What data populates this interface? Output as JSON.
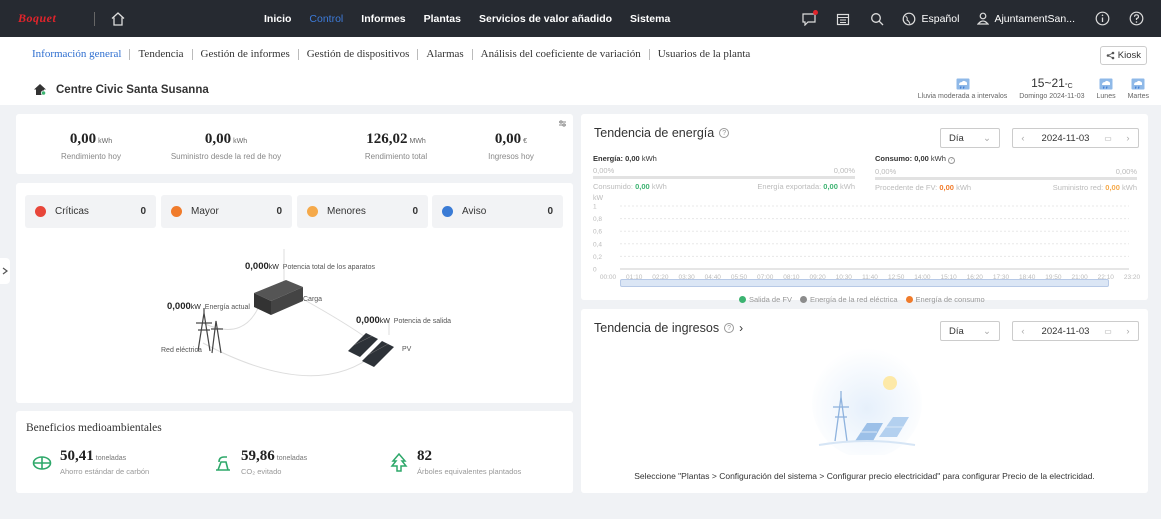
{
  "topbar": {
    "logo": "Boquet",
    "nav": [
      "Inicio",
      "Control",
      "Informes",
      "Plantas",
      "Servicios de valor añadido",
      "Sistema"
    ],
    "active_nav": "Control",
    "language": "Español",
    "user": "AjuntamentSan..."
  },
  "subnav": {
    "items": [
      "Información general",
      "Tendencia",
      "Gestión de informes",
      "Gestión de dispositivos",
      "Alarmas",
      "Análisis del coeficiente de variación",
      "Usuarios de la planta"
    ],
    "active": "Información general",
    "kiosk": "Kiosk"
  },
  "plant": {
    "name": "Centre Civic Santa Susanna"
  },
  "weather": {
    "today_desc": "Lluvia moderada a intervalos",
    "temp": "15~21",
    "temp_unit": "°C",
    "today_label": "Domingo 2024-11-03",
    "day2": "Lunes",
    "day3": "Martes"
  },
  "kpis": [
    {
      "value": "0,00",
      "unit": "kWh",
      "label": "Rendimiento hoy"
    },
    {
      "value": "0,00",
      "unit": "kWh",
      "label": "Suministro desde la red de hoy"
    },
    {
      "value": "126,02",
      "unit": "MWh",
      "label": "Rendimiento total"
    },
    {
      "value": "0,00",
      "unit": "€",
      "label": "Ingresos hoy"
    }
  ],
  "alarms": [
    {
      "label": "Críticas",
      "count": "0",
      "color": "#e8463a"
    },
    {
      "label": "Mayor",
      "count": "0",
      "color": "#f07b2b"
    },
    {
      "label": "Menores",
      "count": "0",
      "color": "#f5a94a"
    },
    {
      "label": "Aviso",
      "count": "0",
      "color": "#3a7bd5"
    }
  ],
  "flow": {
    "load_power": "0,000",
    "load_power_unit": "kW",
    "load_power_label": "Potencia total de los aparatos",
    "load_label": "Carga",
    "grid_power": "0,000",
    "grid_power_unit": "kW",
    "grid_power_label": "Energía actual",
    "grid_label": "Red eléctrica",
    "pv_power": "0,000",
    "pv_power_unit": "kW",
    "pv_power_label": "Potencia de salida",
    "pv_label": "PV"
  },
  "energy": {
    "title": "Tendencia de energía",
    "period": "Día",
    "date": "2024-11-03",
    "produccion_label": "Energía:",
    "produccion_value": "0,00",
    "produccion_unit": "kWh",
    "consumo_label": "Consumo:",
    "consumo_value": "0,00",
    "consumo_unit": "kWh",
    "pct_left_a": "0,00%",
    "pct_left_b": "0,00%",
    "pct_right_a": "0,00%",
    "pct_right_b": "0,00%",
    "consumido_label": "Consumido:",
    "consumido_value": "0,00",
    "exportada_label": "Energía exportada:",
    "exportada_value": "0,00",
    "fv_label": "Procedente de FV:",
    "fv_value": "0,00",
    "red_label": "Suministro red:",
    "red_value": "0,00",
    "unit": "kWh",
    "legend": [
      "Salida de FV",
      "Energía de la red eléctrica",
      "Energía de consumo"
    ]
  },
  "chart_data": {
    "type": "line",
    "ylabel": "kW",
    "ylim": [
      0,
      1
    ],
    "yticks": [
      "1",
      "0,8",
      "0,6",
      "0,4",
      "0,2",
      "0"
    ],
    "categories": [
      "00:00",
      "01:10",
      "02:20",
      "03:30",
      "04:40",
      "05:50",
      "07:00",
      "08:10",
      "09:20",
      "10:30",
      "11:40",
      "12:50",
      "14:00",
      "15:10",
      "16:20",
      "17:30",
      "18:40",
      "19:50",
      "21:00",
      "22:10",
      "23:20"
    ],
    "series": [
      {
        "name": "Salida de FV",
        "color": "#3cb371",
        "values": []
      },
      {
        "name": "Energía de la red eléctrica",
        "color": "#8c8c8c",
        "values": []
      },
      {
        "name": "Energía de consumo",
        "color": "#f07b2b",
        "values": []
      }
    ]
  },
  "revenue": {
    "title": "Tendencia de ingresos",
    "period": "Día",
    "date": "2024-11-03",
    "message": "Seleccione \"Plantas > Configuración del sistema > Configurar precio electricidad\" para configurar Precio de la electricidad."
  },
  "benefits": {
    "title": "Beneficios medioambientales",
    "items": [
      {
        "value": "50,41",
        "unit": "toneladas",
        "label": "Ahorro estándar de carbón",
        "icon": "coal-icon"
      },
      {
        "value": "59,86",
        "unit": "toneladas",
        "label": "CO₂ evitado",
        "icon": "co2-icon"
      },
      {
        "value": "82",
        "unit": "",
        "label": "Árboles equivalentes plantados",
        "icon": "tree-icon"
      }
    ]
  }
}
